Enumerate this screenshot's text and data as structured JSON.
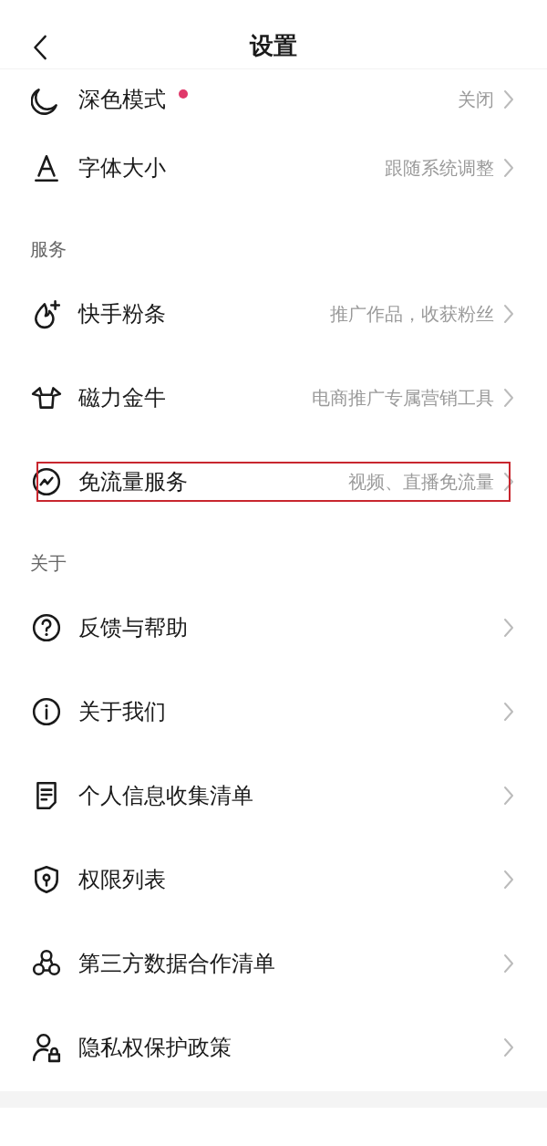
{
  "header": {
    "title": "设置"
  },
  "sections": [
    {
      "items": [
        {
          "label": "深色模式",
          "value": "关闭",
          "badge_dot": true,
          "highlighted": false
        },
        {
          "label": "字体大小",
          "value": "跟随系统调整",
          "badge_dot": false,
          "highlighted": false
        }
      ]
    },
    {
      "title": "服务",
      "items": [
        {
          "label": "快手粉条",
          "value": "推广作品，收获粉丝",
          "badge_dot": false,
          "highlighted": false
        },
        {
          "label": "磁力金牛",
          "value": "电商推广专属营销工具",
          "badge_dot": false,
          "highlighted": false
        },
        {
          "label": "免流量服务",
          "value": "视频、直播免流量",
          "badge_dot": false,
          "highlighted": true
        }
      ]
    },
    {
      "title": "关于",
      "items": [
        {
          "label": "反馈与帮助",
          "badge_dot": false,
          "highlighted": false
        },
        {
          "label": "关于我们",
          "badge_dot": false,
          "highlighted": false
        },
        {
          "label": "个人信息收集清单",
          "badge_dot": false,
          "highlighted": false
        },
        {
          "label": "权限列表",
          "badge_dot": false,
          "highlighted": false
        },
        {
          "label": "第三方数据合作清单",
          "badge_dot": false,
          "highlighted": false
        },
        {
          "label": "隐私权保护政策",
          "badge_dot": false,
          "highlighted": false
        }
      ]
    }
  ]
}
